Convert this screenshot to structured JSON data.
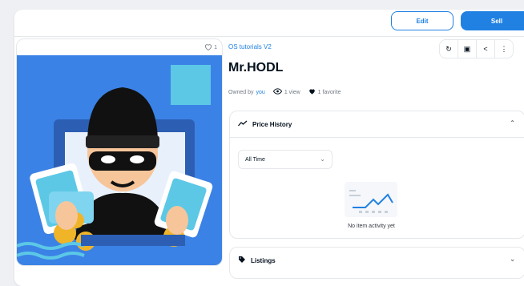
{
  "header": {
    "edit_label": "Edit",
    "sell_label": "Sell"
  },
  "media": {
    "favorite_count": "1"
  },
  "asset": {
    "collection": "OS tutorials V2",
    "title": "Mr.HODL",
    "owned_by_label": "Owned by",
    "owner": "you",
    "views": "1 view",
    "favorites": "1 favorite"
  },
  "actions": [
    {
      "icon": "refresh-icon"
    },
    {
      "icon": "gift-icon"
    },
    {
      "icon": "share-icon"
    },
    {
      "icon": "more-icon"
    }
  ],
  "price_history": {
    "label": "Price History",
    "filter_value": "All Time",
    "empty_text": "No item activity yet"
  },
  "listings": {
    "label": "Listings"
  },
  "colors": {
    "accent": "#2081e2",
    "art_bg": "#3b82e6"
  }
}
